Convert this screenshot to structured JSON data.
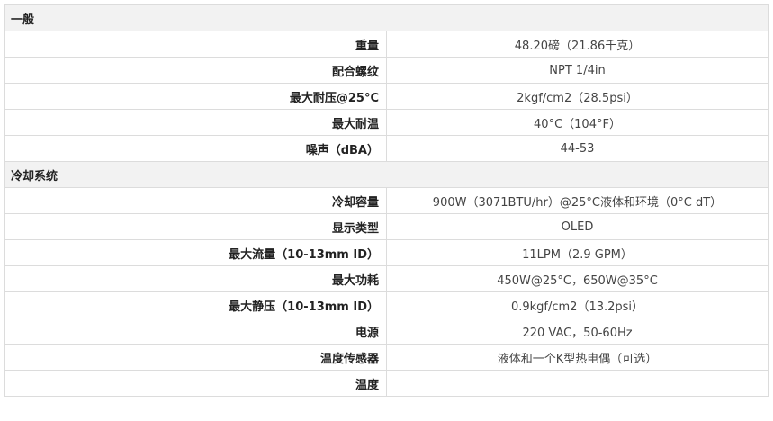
{
  "sections": [
    {
      "title": "一般",
      "rows": [
        {
          "label": "重量",
          "value": "48.20磅（21.86千克）"
        },
        {
          "label": "配合螺纹",
          "value": "NPT 1/4in"
        },
        {
          "label": "最大耐压@25°C",
          "value": "2kgf/cm2（28.5psi）"
        },
        {
          "label": "最大耐温",
          "value": "40°C（104°F）"
        },
        {
          "label": "噪声（dBA）",
          "value": "44-53"
        }
      ]
    },
    {
      "title": "冷却系统",
      "rows": [
        {
          "label": "冷却容量",
          "value": "900W（3071BTU/hr）@25°C液体和环境（0°C dT）"
        },
        {
          "label": "显示类型",
          "value": "OLED"
        },
        {
          "label": "最大流量（10-13mm ID）",
          "value": "11LPM（2.9 GPM）"
        },
        {
          "label": "最大功耗",
          "value": "450W@25°C，650W@35°C"
        },
        {
          "label": "最大静压（10-13mm ID）",
          "value": "0.9kgf/cm2（13.2psi）"
        },
        {
          "label": "电源",
          "value": "220 VAC，50-60Hz"
        },
        {
          "label": "温度传感器",
          "value": "液体和一个K型热电偶（可选）"
        },
        {
          "label": "温度",
          "value": ""
        }
      ]
    }
  ]
}
